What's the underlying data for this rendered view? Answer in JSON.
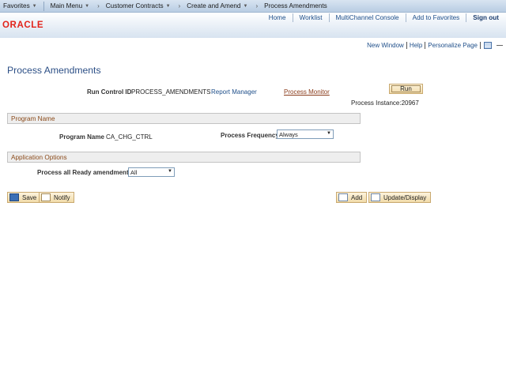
{
  "nav": {
    "favorites": "Favorites",
    "main_menu": "Main Menu",
    "crumb1": "Customer Contracts",
    "crumb2": "Create and Amend",
    "crumb3": "Process Amendments"
  },
  "header": {
    "logo": "ORACLE",
    "links": [
      "Home",
      "Worklist",
      "MultiChannel Console",
      "Add to Favorites"
    ],
    "signout": "Sign out"
  },
  "pagelinks": [
    "New Window",
    "Help",
    "Personalize Page"
  ],
  "page": {
    "title": "Process Amendments",
    "run_control_label": "Run Control ID",
    "run_control_value": "PROCESS_AMENDMENTS",
    "report_manager": "Report Manager",
    "process_monitor": "Process Monitor",
    "run_button": "Run",
    "process_instance": "Process Instance:20967"
  },
  "program_section": {
    "title": "Program Name",
    "program_name_label": "Program Name",
    "program_name_value": "CA_CHG_CTRL",
    "frequency_label": "Process Frequency",
    "frequency_value": "Always"
  },
  "app_options": {
    "title": "Application Options",
    "ready_label": "Process all Ready amendments",
    "ready_value": "All"
  },
  "toolbar": {
    "save": "Save",
    "notify": "Notify",
    "add": "Add",
    "update": "Update/Display"
  }
}
